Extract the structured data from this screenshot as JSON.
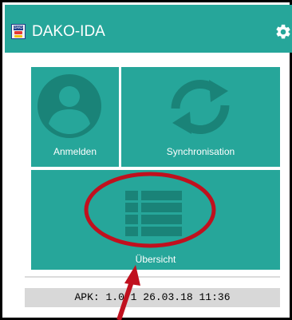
{
  "appbar": {
    "title": "DAKO-IDA",
    "logo_text": "DAKO",
    "settings_icon": "gear-icon"
  },
  "tiles": [
    {
      "label": "Anmelden",
      "icon": "person-circle-icon"
    },
    {
      "label": "Synchronisation",
      "icon": "sync-arrows-icon"
    },
    {
      "label": "Übersicht",
      "icon": "list-grid-icon"
    }
  ],
  "footer": {
    "apk_text": "APK: 1.0.1 26.03.18 11:36"
  },
  "colors": {
    "accent": "#26a69a",
    "icon_tint": "#1a8378",
    "annotation": "#c0101e"
  }
}
